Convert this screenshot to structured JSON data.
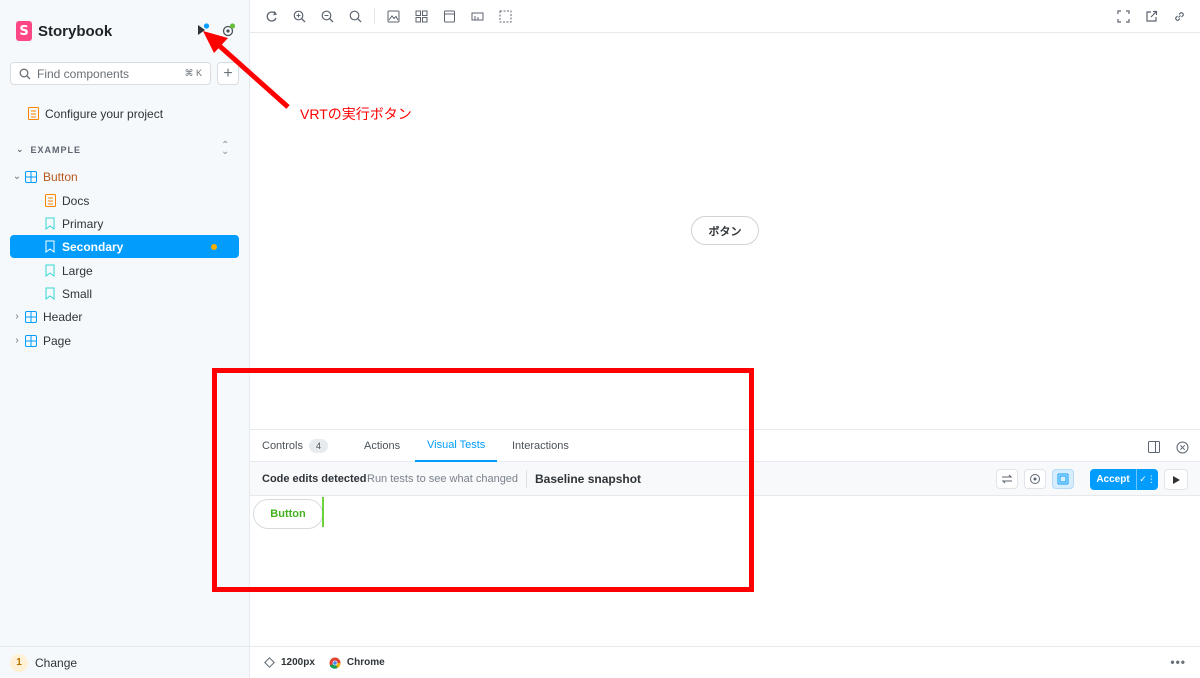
{
  "brand": {
    "name": "Storybook",
    "logo_letter": "S",
    "color": "#ff4785"
  },
  "sidebar": {
    "search_placeholder": "Find components",
    "search_shortcut": "⌘ K",
    "configure_label": "Configure your project",
    "group_label": "EXAMPLE",
    "items": [
      {
        "label": "Button",
        "type": "component",
        "expanded": true
      },
      {
        "label": "Docs",
        "type": "docs"
      },
      {
        "label": "Primary",
        "type": "story"
      },
      {
        "label": "Secondary",
        "type": "story",
        "selected": true
      },
      {
        "label": "Large",
        "type": "story"
      },
      {
        "label": "Small",
        "type": "story"
      },
      {
        "label": "Header",
        "type": "component",
        "expanded": false
      },
      {
        "label": "Page",
        "type": "component",
        "expanded": false
      }
    ],
    "change_count": "1",
    "change_label": "Change"
  },
  "canvas": {
    "preview_button_label": "ボタン"
  },
  "panel": {
    "tabs": [
      {
        "label": "Controls",
        "count": "4"
      },
      {
        "label": "Actions"
      },
      {
        "label": "Visual Tests",
        "active": true
      },
      {
        "label": "Interactions"
      }
    ],
    "visual_tests": {
      "status_title": "Code edits detected",
      "status_sub": "Run tests to see what changed",
      "baseline_label": "Baseline snapshot",
      "accept_label": "Accept",
      "snapshot_button_label": "Button"
    }
  },
  "footer": {
    "viewport": "1200px",
    "browser": "Chrome"
  },
  "annotation": {
    "text": "VRTの実行ボタン",
    "color": "#ff0000"
  },
  "colors": {
    "accent": "#029cfd",
    "story_icon": "#37d5d3",
    "component_icon": "#029cfd",
    "docs_icon": "#ff8300"
  }
}
